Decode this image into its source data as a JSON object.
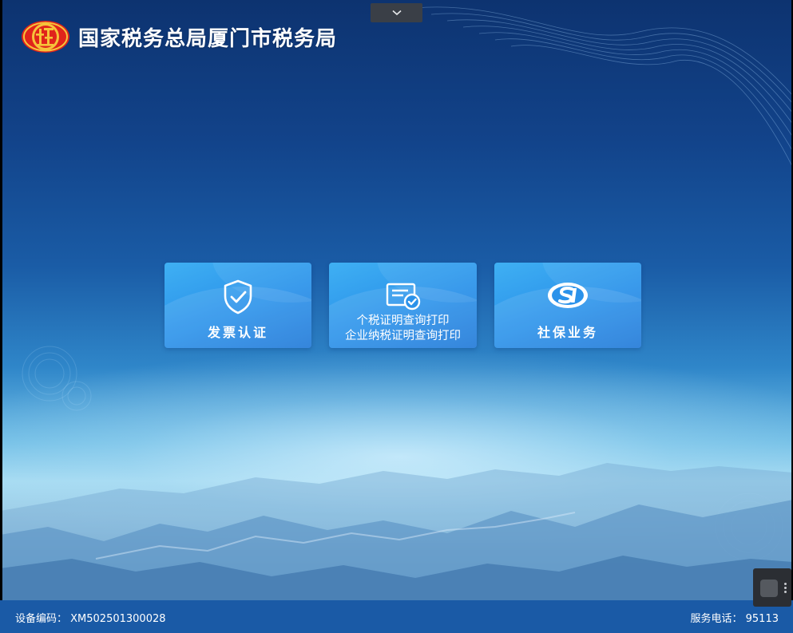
{
  "header": {
    "title": "国家税务总局厦门市税务局",
    "emblem_icon": "tax-emblem-icon"
  },
  "top_toggle": {
    "icon": "chevron-down-icon"
  },
  "tiles": [
    {
      "icon": "shield-check-icon",
      "label": "发票认证"
    },
    {
      "icon": "certificate-check-icon",
      "label_line1": "个税证明查询打印",
      "label_line2": "企业纳税证明查询打印"
    },
    {
      "icon": "social-security-si-icon",
      "label": "社保业务"
    }
  ],
  "status_bar": {
    "device_code": "设备编码：  XM502501300028",
    "service_phone": "服务电话：  95113"
  },
  "corner_widget": {
    "icon": "app-launcher-icon"
  },
  "colors": {
    "tile": "#2b92ea",
    "status_bar": "#1a5aa6",
    "background_top": "#0d3370",
    "background_horizon": "#a8dcf2"
  }
}
